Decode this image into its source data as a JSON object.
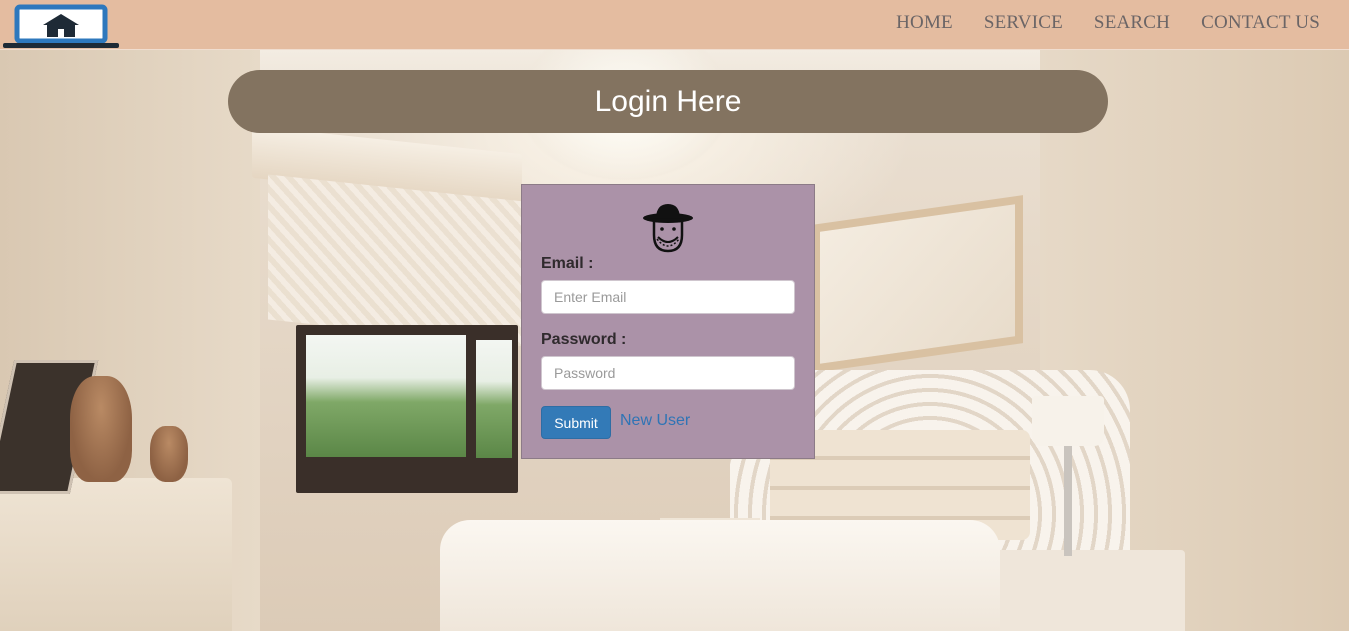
{
  "nav": {
    "items": [
      "HOME",
      "SERVICE",
      "SEARCH",
      "CONTACT US"
    ]
  },
  "banner": {
    "title": "Login Here"
  },
  "form": {
    "email_label": "Email :",
    "email_placeholder": "Enter Email",
    "password_label": "Password :",
    "password_placeholder": "Password",
    "submit_label": "Submit",
    "new_user_link": "New User"
  },
  "icons": {
    "logo": "house-laptop-icon",
    "avatar": "user-avatar-icon"
  },
  "colors": {
    "header": "#e4bca0",
    "banner": "#837360",
    "card": "#ab92a8",
    "button": "#337ab7",
    "link": "#2f74b5",
    "nav_text": "#6b6566"
  }
}
